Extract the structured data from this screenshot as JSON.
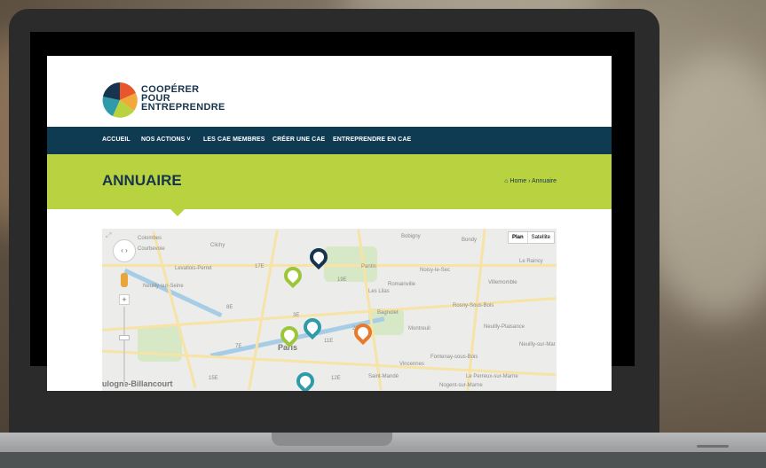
{
  "site": {
    "brand_lines": [
      "COOPÉRER",
      "POUR",
      "ENTREPRENDRE"
    ],
    "nav": [
      "ACCUEIL",
      "NOS ACTIONS ˅",
      "LES CAE MEMBRES",
      "CRÉER UNE CAE",
      "ENTREPRENDRE EN CAE"
    ],
    "page_title": "ANNUAIRE",
    "breadcrumb": "⌂ Home › Annuaire"
  },
  "map": {
    "type_buttons": [
      "Plan",
      "Satellite"
    ],
    "labels": [
      "Colombes",
      "Clichy",
      "Courbevoie",
      "Levallois-Perret",
      "Neuilly-sur-Seine",
      "Pantin",
      "Bobigny",
      "Bondy",
      "Noisy-le-Sec",
      "Romainville",
      "Les Lilas",
      "Le Raincy",
      "Villemomble",
      "Rosny-Sous-Bois",
      "Bagnolet",
      "Montreuil",
      "Neuilly-Plaisance",
      "Neuilly-sur-Mar",
      "Fontenay-sous-Bois",
      "Vincennes",
      "Saint-Mandé",
      "Le Perreux-sur-Marne",
      "Nogent-sur-Marne",
      "Paris",
      "ulogne-Billancourt",
      "17E",
      "12E",
      "8E",
      "11E",
      "15E",
      "7E",
      "19E",
      "3E",
      "20E"
    ],
    "pin_colors": [
      "#16344f",
      "#9cc63a",
      "#2f9aa8",
      "#9cc63a",
      "#e87a2c",
      "#2f9aa8"
    ]
  }
}
